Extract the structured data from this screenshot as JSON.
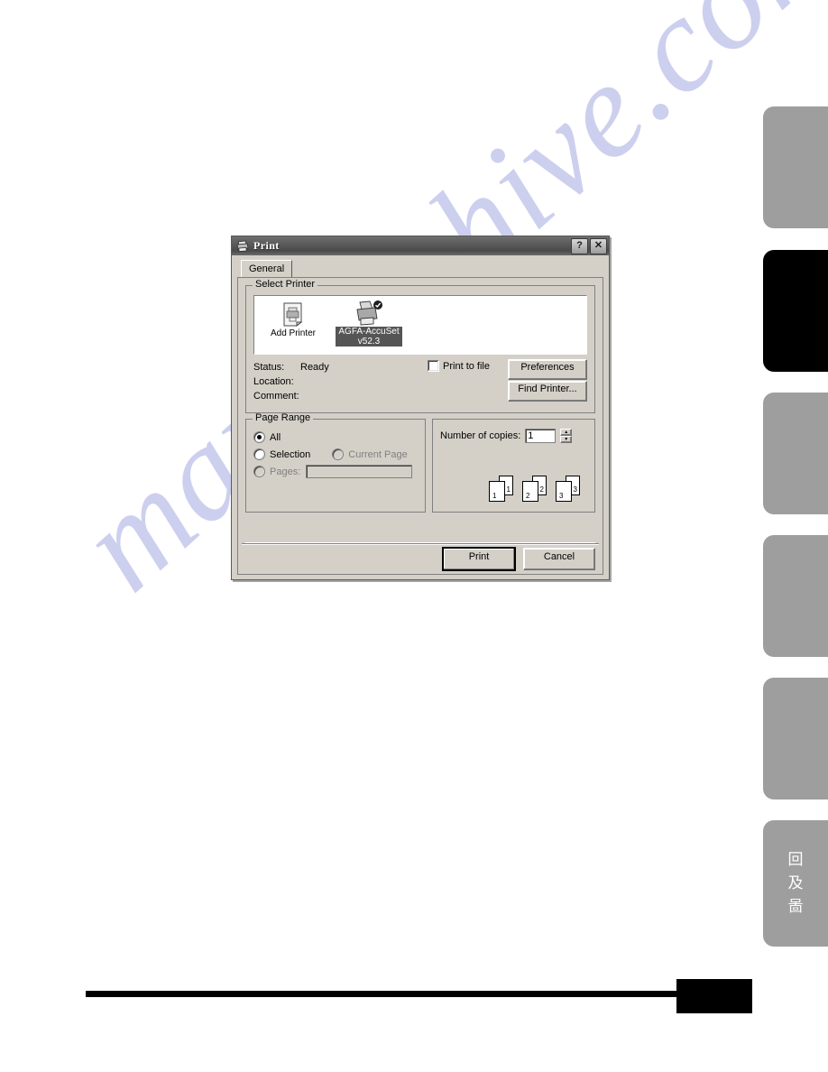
{
  "page": {
    "background_color": "#ffffff",
    "watermark": {
      "text": "manualshive.com",
      "color": "#c9cced"
    },
    "footer": {
      "rule_color": "#000000",
      "page_block_color": "#000000"
    }
  },
  "sidebar": {
    "active_index": 1,
    "inactive_color": "#9e9e9e",
    "active_color": "#000000",
    "tabs": [
      {
        "name": "side-tab-1",
        "label": "",
        "active": false,
        "glyphs": []
      },
      {
        "name": "side-tab-2",
        "label": "",
        "active": true,
        "glyphs": []
      },
      {
        "name": "side-tab-3",
        "label": "",
        "active": false,
        "glyphs": []
      },
      {
        "name": "side-tab-4",
        "label": "",
        "active": false,
        "glyphs": []
      },
      {
        "name": "side-tab-5",
        "label": "",
        "active": false,
        "glyphs": []
      },
      {
        "name": "side-tab-6",
        "label": "",
        "active": false,
        "glyphs": [
          "回",
          "及",
          "啚"
        ]
      }
    ]
  },
  "dialog": {
    "title": "Print",
    "titlebar_icon": "printer-icon",
    "help_button": "?",
    "close_button": "✕",
    "tabs": [
      {
        "label": "General",
        "selected": true
      }
    ],
    "select_printer": {
      "title": "Select Printer",
      "printers": [
        {
          "name": "Add Printer",
          "label": "Add Printer",
          "icon": "add-printer-icon",
          "selected": false
        },
        {
          "name": "AGFA-AccuSet v52.3",
          "label": "AGFA-AccuSet v52.3",
          "icon": "printer-default-icon",
          "selected": true
        }
      ],
      "status_label": "Status:",
      "status_value": "Ready",
      "location_label": "Location:",
      "location_value": "",
      "comment_label": "Comment:",
      "comment_value": "",
      "print_to_file_label": "Print to file",
      "print_to_file_checked": false,
      "preferences_button": "Preferences",
      "find_printer_button": "Find Printer..."
    },
    "page_range": {
      "title": "Page Range",
      "options": [
        {
          "label": "All",
          "selected": true,
          "enabled": true
        },
        {
          "label": "Selection",
          "selected": false,
          "enabled": true
        },
        {
          "label": "Current Page",
          "selected": false,
          "enabled": false
        },
        {
          "label": "Pages:",
          "selected": false,
          "enabled": false
        }
      ],
      "pages_input_value": "",
      "pages_input_enabled": false
    },
    "copies": {
      "label": "Number of copies:",
      "value": "1",
      "spin_up": "▲",
      "spin_down": "▼",
      "collate_preview": [
        {
          "front": "1",
          "back": "1"
        },
        {
          "front": "2",
          "back": "2"
        },
        {
          "front": "3",
          "back": "3"
        }
      ]
    },
    "footer": {
      "print_button": "Print",
      "cancel_button": "Cancel"
    }
  }
}
